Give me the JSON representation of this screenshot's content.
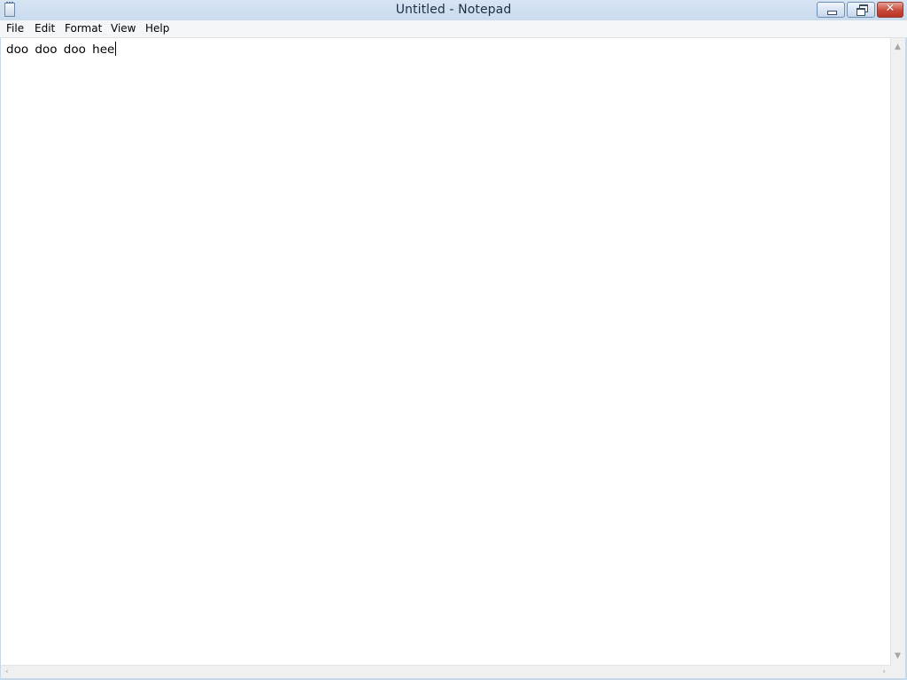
{
  "window": {
    "title": "Untitled - Notepad"
  },
  "title_buttons": {
    "close_glyph": "✕"
  },
  "menu": {
    "items": [
      {
        "label": "File"
      },
      {
        "label": "Edit"
      },
      {
        "label": "Format"
      },
      {
        "label": "View"
      },
      {
        "label": "Help"
      }
    ]
  },
  "editor": {
    "content": "doo doo doo hee"
  },
  "icons": {
    "app": "notepad-icon",
    "minimize": "minimize-icon",
    "maximize": "restore-icon",
    "close": "close-icon",
    "scroll_up": "chevron-up-icon",
    "scroll_down": "chevron-down-icon",
    "scroll_left": "chevron-left-icon",
    "scroll_right": "chevron-right-icon"
  },
  "scroll_arrows": {
    "up": "▲",
    "down": "▼",
    "left": "‹",
    "right": "›"
  },
  "colors": {
    "titlebar": "#c9dbee",
    "close_button": "#c8493a",
    "menubar": "#f5f6f7",
    "editor_background": "#ffffff"
  }
}
